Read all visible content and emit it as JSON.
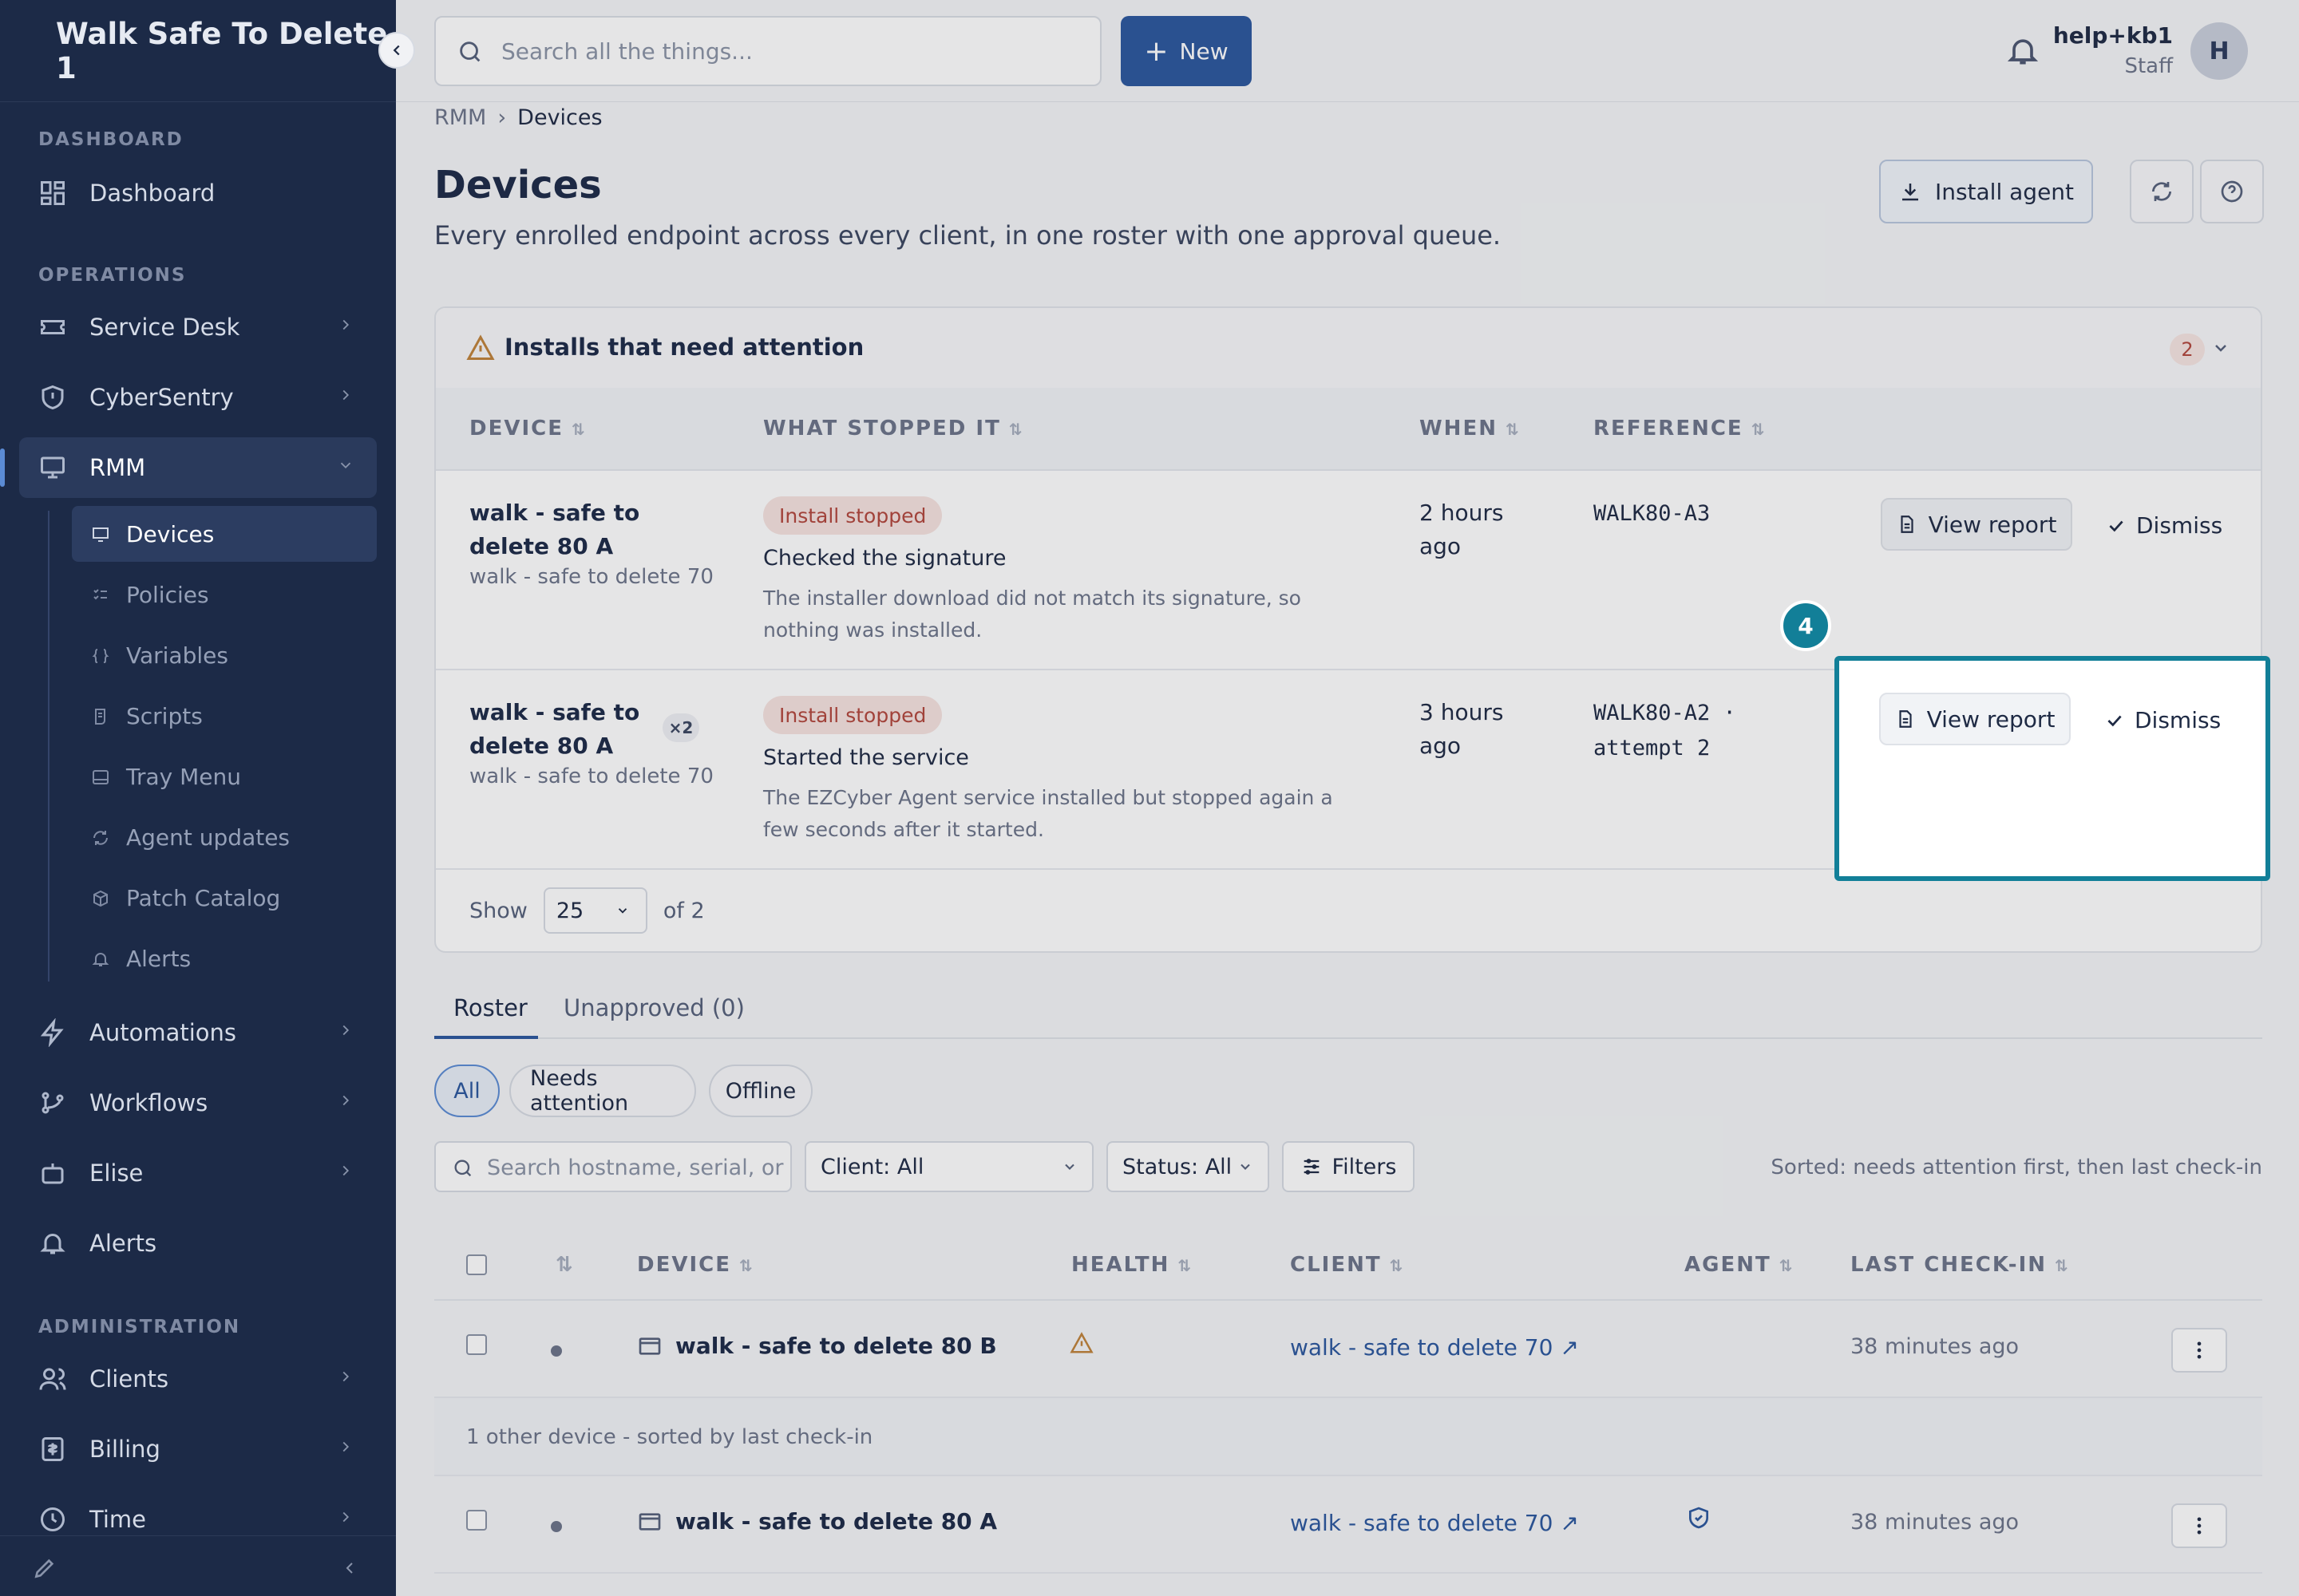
{
  "sidebar": {
    "brand": "Walk Safe To Delete 1",
    "sections": {
      "dashboard": "DASHBOARD",
      "operations": "OPERATIONS",
      "administration": "ADMINISTRATION"
    },
    "items": {
      "dashboard": "Dashboard",
      "service_desk": "Service Desk",
      "cybersentry": "CyberSentry",
      "rmm": "RMM",
      "automations": "Automations",
      "workflows": "Workflows",
      "elise": "Elise",
      "alerts": "Alerts",
      "clients": "Clients",
      "billing": "Billing",
      "time": "Time"
    },
    "rmm_sub": {
      "devices": "Devices",
      "policies": "Policies",
      "variables": "Variables",
      "scripts": "Scripts",
      "tray_menu": "Tray Menu",
      "agent_updates": "Agent updates",
      "patch_catalog": "Patch Catalog",
      "alerts": "Alerts"
    }
  },
  "topbar": {
    "search_placeholder": "Search all the things...",
    "new_label": "New",
    "user_name": "help+kb1",
    "user_role": "Staff",
    "avatar_initial": "H"
  },
  "breadcrumb": {
    "parent": "RMM",
    "current": "Devices",
    "separator": "›"
  },
  "page": {
    "title": "Devices",
    "subtitle": "Every enrolled endpoint across every client, in one roster with one approval queue.",
    "install_agent_label": "Install agent"
  },
  "attention": {
    "title": "Installs that need attention",
    "count": "2",
    "columns": {
      "device": "DEVICE",
      "what": "WHAT STOPPED IT",
      "when": "WHEN",
      "reference": "REFERENCE"
    },
    "rows": [
      {
        "device": "walk - safe to delete 80 A",
        "client": "walk - safe to delete 70",
        "status": "Install stopped",
        "step": "Checked the signature",
        "detail": "The installer download did not match its signature, so nothing was installed.",
        "when": "2 hours ago",
        "reference": "WALK80-A3",
        "view_report": "View report",
        "dismiss": "Dismiss"
      },
      {
        "device": "walk - safe to delete 80 A",
        "multiplier": "×2",
        "client": "walk - safe to delete 70",
        "status": "Install stopped",
        "step": "Started the service",
        "detail": "The EZCyber Agent service installed but stopped again a few seconds after it started.",
        "when": "3 hours ago",
        "reference": "WALK80-A2 · attempt 2",
        "view_report": "View report",
        "dismiss": "Dismiss"
      }
    ],
    "pager": {
      "show": "Show",
      "page_size": "25",
      "of": "of 2"
    },
    "step_badge": "4"
  },
  "tabs": {
    "roster": "Roster",
    "unapproved": "Unapproved (0)"
  },
  "filters": {
    "pills": {
      "all": "All",
      "needs_attention": "Needs attention",
      "offline": "Offline"
    },
    "search_placeholder": "Search hostname, serial, or",
    "client": "Client: All",
    "status": "Status: All",
    "filters_label": "Filters",
    "sorted": "Sorted: needs attention first, then last check-in"
  },
  "roster": {
    "columns": {
      "device": "DEVICE",
      "health": "HEALTH",
      "client": "CLIENT",
      "agent": "AGENT",
      "last_checkin": "LAST CHECK-IN"
    },
    "rows": [
      {
        "device": "walk - safe to delete 80 B",
        "client": "walk - safe to delete 70 ↗",
        "last_checkin": "38 minutes ago"
      },
      {
        "device": "walk - safe to delete 80 A",
        "client": "walk - safe to delete 70 ↗",
        "last_checkin": "38 minutes ago"
      }
    ],
    "group_note": "1 other device - sorted by last check-in"
  }
}
